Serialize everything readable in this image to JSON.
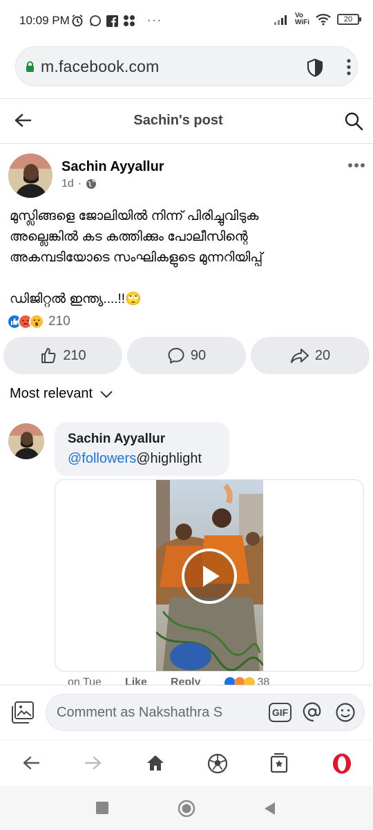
{
  "status_bar": {
    "time": "10:09 PM",
    "icons": [
      "alarm-icon",
      "whatsapp-icon",
      "facebook-icon",
      "app-icon",
      "more-dots-icon"
    ],
    "network_label": "Vo\nWiFi",
    "battery": "20"
  },
  "browser": {
    "url": "m.facebook.com"
  },
  "header": {
    "title": "Sachin's post"
  },
  "post": {
    "author": "Sachin Ayyallur",
    "time": "1d",
    "text_line1": "മുസ്ലിങ്ങളെ ജോലിയിൽ നിന്ന് പിരിച്ചുവിടുക",
    "text_line2": "അല്ലെങ്കിൽ കട കത്തിക്കും പോലീസിന്റെ",
    "text_line3": "അകമ്പടിയോടെ സംഘികളുടെ മുന്നറിയിപ്പ്",
    "text_line4": "ഡിജിറ്റൽ ഇന്ത്യ....!!🙄",
    "reaction_count": "210",
    "like_count": "210",
    "comment_count": "90",
    "share_count": "20"
  },
  "comments": {
    "sort_label": "Most relevant",
    "first": {
      "author": "Sachin Ayyallur",
      "mention": "@followers",
      "text": "@highlight",
      "time": "on Tue",
      "like_label": "Like",
      "reply_label": "Reply",
      "reaction_count": "38"
    }
  },
  "composer": {
    "placeholder": "Comment as Nakshathra S",
    "gif_label": "GIF"
  },
  "colors": {
    "facebook_blue": "#1b74e4",
    "opera_red": "#e4132b",
    "secure_green": "#1e8e3e"
  }
}
